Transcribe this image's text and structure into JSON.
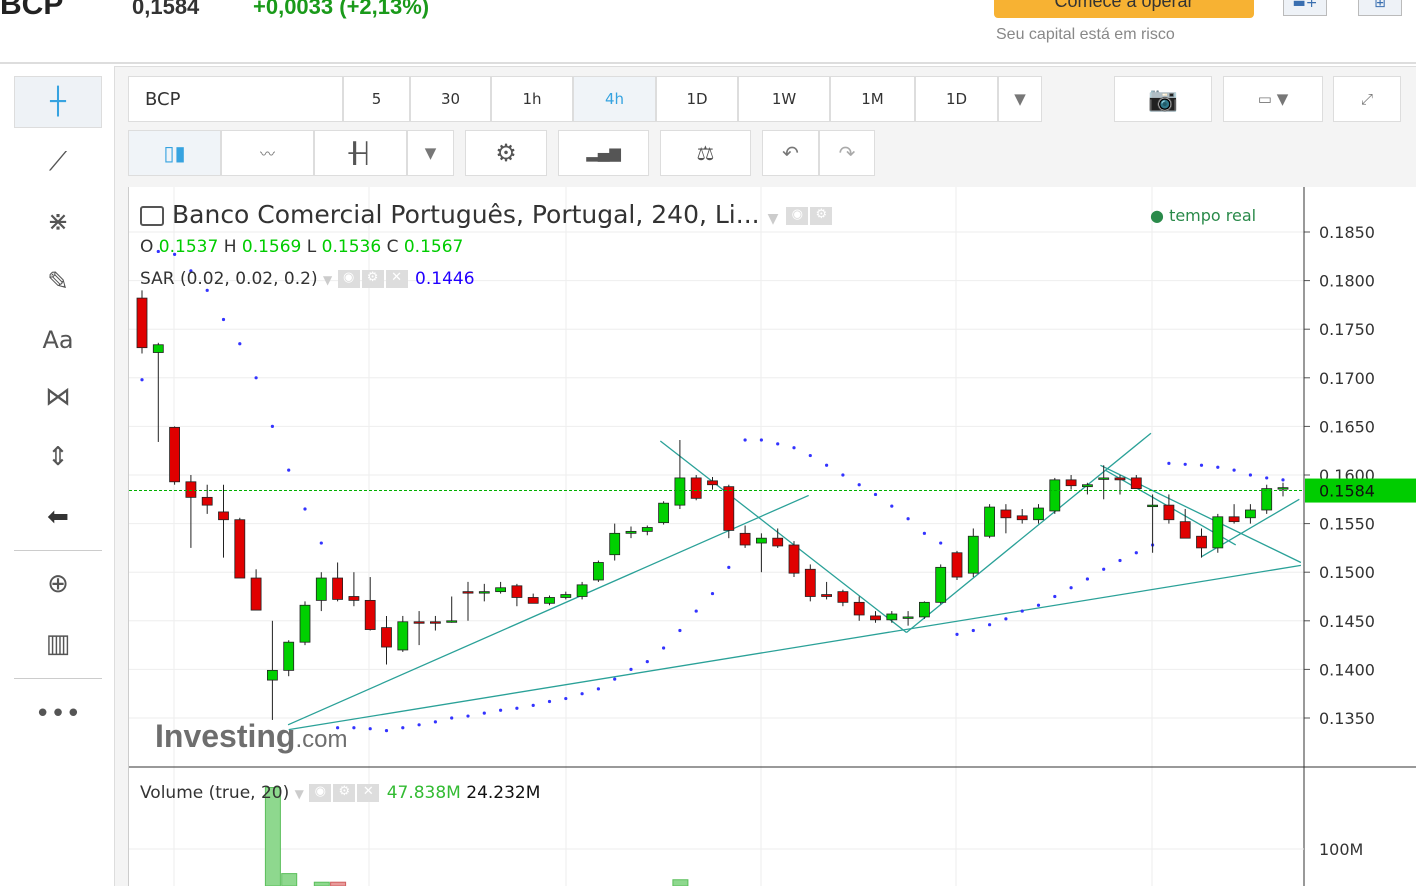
{
  "header": {
    "symbol": "BCP",
    "price": "0,1584",
    "change": "+0,0033 (+2,13%)",
    "cta": "Comece a operar",
    "risk": "Seu capital está em risco"
  },
  "toolbar": {
    "symbol": "BCP",
    "intervals": [
      "5",
      "30",
      "1h",
      "4h",
      "1D",
      "1W",
      "1M",
      "1D"
    ],
    "active_interval": "4h"
  },
  "legend": {
    "title": "Banco Comercial Português, Portugal, 240, Li...",
    "realtime": "tempo real",
    "o_label": "O",
    "o": "0.1537",
    "h_label": "H",
    "h": "0.1569",
    "l_label": "L",
    "l": "0.1536",
    "c_label": "C",
    "c": "0.1567",
    "sar_label": "SAR (0.02, 0.02, 0.2)",
    "sar_value": "0.1446",
    "vol_label": "Volume (true, 20)",
    "vol_value1": "47.838M",
    "vol_value2": "24.232M"
  },
  "logo": "Investing.com",
  "colors": {
    "up": "#00d000",
    "down": "#e00000",
    "sar": "#3333ff",
    "trend": "#2aa198",
    "price_line": "#00b000"
  },
  "chart_data": {
    "type": "candlestick",
    "price_axis": {
      "ticks": [
        "0.1850",
        "0.1800",
        "0.1750",
        "0.1700",
        "0.1650",
        "0.1600",
        "0.1550",
        "0.1500",
        "0.1450",
        "0.1400",
        "0.1350"
      ],
      "ylim": [
        0.1325,
        0.1875
      ]
    },
    "current_price": "0.1584",
    "volume_axis": {
      "ticks": [
        "100M"
      ]
    },
    "ohlc": [
      [
        0.1782,
        0.179,
        0.1725,
        0.1731
      ],
      [
        0.1726,
        0.1736,
        0.1634,
        0.1734
      ],
      [
        0.1649,
        0.165,
        0.159,
        0.1593
      ],
      [
        0.1593,
        0.16,
        0.1525,
        0.1577
      ],
      [
        0.1577,
        0.159,
        0.156,
        0.1569
      ],
      [
        0.1562,
        0.159,
        0.1515,
        0.1554
      ],
      [
        0.1554,
        0.1556,
        0.1494,
        0.1494
      ],
      [
        0.1494,
        0.1503,
        0.1461,
        0.1461
      ],
      [
        0.1389,
        0.145,
        0.1348,
        0.1399
      ],
      [
        0.1399,
        0.143,
        0.1393,
        0.1428
      ],
      [
        0.1428,
        0.147,
        0.1425,
        0.1466
      ],
      [
        0.1471,
        0.15,
        0.146,
        0.1494
      ],
      [
        0.1494,
        0.151,
        0.147,
        0.1472
      ],
      [
        0.1475,
        0.15,
        0.1465,
        0.1471
      ],
      [
        0.1471,
        0.1495,
        0.144,
        0.1441
      ],
      [
        0.1443,
        0.1455,
        0.1405,
        0.1423
      ],
      [
        0.142,
        0.1455,
        0.1418,
        0.1449
      ],
      [
        0.1449,
        0.146,
        0.1425,
        0.1448
      ],
      [
        0.1449,
        0.1455,
        0.144,
        0.1448
      ],
      [
        0.145,
        0.1475,
        0.1448,
        0.145
      ],
      [
        0.148,
        0.149,
        0.145,
        0.1479
      ],
      [
        0.148,
        0.1488,
        0.147,
        0.148
      ],
      [
        0.148,
        0.149,
        0.1478,
        0.1484
      ],
      [
        0.1486,
        0.1488,
        0.1465,
        0.1474
      ],
      [
        0.1474,
        0.1478,
        0.1468,
        0.1468
      ],
      [
        0.1468,
        0.1476,
        0.1466,
        0.1474
      ],
      [
        0.1474,
        0.148,
        0.1472,
        0.1477
      ],
      [
        0.1475,
        0.149,
        0.1472,
        0.1487
      ],
      [
        0.1492,
        0.1512,
        0.149,
        0.151
      ],
      [
        0.1518,
        0.155,
        0.1512,
        0.154
      ],
      [
        0.154,
        0.1547,
        0.1535,
        0.1542
      ],
      [
        0.1542,
        0.1548,
        0.1538,
        0.1546
      ],
      [
        0.1551,
        0.1573,
        0.1549,
        0.1571
      ],
      [
        0.1569,
        0.1636,
        0.1565,
        0.1597
      ],
      [
        0.1597,
        0.16,
        0.1574,
        0.1576
      ],
      [
        0.1594,
        0.1598,
        0.1585,
        0.159
      ],
      [
        0.1588,
        0.159,
        0.1535,
        0.1543
      ],
      [
        0.154,
        0.1548,
        0.1525,
        0.1528
      ],
      [
        0.153,
        0.154,
        0.15,
        0.1535
      ],
      [
        0.1535,
        0.1545,
        0.1525,
        0.1527
      ],
      [
        0.1528,
        0.1532,
        0.1495,
        0.1499
      ],
      [
        0.1503,
        0.1508,
        0.147,
        0.1475
      ],
      [
        0.1477,
        0.149,
        0.1472,
        0.1475
      ],
      [
        0.148,
        0.1482,
        0.1465,
        0.1469
      ],
      [
        0.1469,
        0.1475,
        0.145,
        0.1456
      ],
      [
        0.1455,
        0.146,
        0.1448,
        0.1451
      ],
      [
        0.1451,
        0.146,
        0.1448,
        0.1457
      ],
      [
        0.1454,
        0.146,
        0.1445,
        0.1454
      ],
      [
        0.1454,
        0.147,
        0.1452,
        0.1469
      ],
      [
        0.1469,
        0.1508,
        0.1467,
        0.1505
      ],
      [
        0.152,
        0.1522,
        0.1492,
        0.1495
      ],
      [
        0.1499,
        0.1545,
        0.1495,
        0.1537
      ],
      [
        0.1537,
        0.157,
        0.1535,
        0.1567
      ],
      [
        0.1564,
        0.157,
        0.154,
        0.1556
      ],
      [
        0.1558,
        0.1565,
        0.155,
        0.1554
      ],
      [
        0.1554,
        0.157,
        0.155,
        0.1566
      ],
      [
        0.1563,
        0.1597,
        0.156,
        0.1595
      ],
      [
        0.1595,
        0.16,
        0.1585,
        0.1589
      ],
      [
        0.1588,
        0.1592,
        0.158,
        0.159
      ],
      [
        0.1597,
        0.161,
        0.1575,
        0.1597
      ],
      [
        0.1597,
        0.16,
        0.158,
        0.1595
      ],
      [
        0.1597,
        0.16,
        0.1586,
        0.1586
      ],
      [
        0.1569,
        0.158,
        0.152,
        0.1569
      ],
      [
        0.1569,
        0.158,
        0.155,
        0.1554
      ],
      [
        0.1552,
        0.1565,
        0.1535,
        0.1535
      ],
      [
        0.1537,
        0.1545,
        0.1515,
        0.1525
      ],
      [
        0.1525,
        0.156,
        0.152,
        0.1557
      ],
      [
        0.1557,
        0.157,
        0.155,
        0.1552
      ],
      [
        0.1556,
        0.157,
        0.155,
        0.1564
      ],
      [
        0.1564,
        0.159,
        0.156,
        0.1586
      ],
      [
        0.1586,
        0.1592,
        0.1578,
        0.1587
      ]
    ],
    "sar": [
      0.1698,
      0.183,
      0.1827,
      0.181,
      0.179,
      0.176,
      0.1735,
      0.17,
      0.165,
      0.1605,
      0.1565,
      0.153,
      0.134,
      0.134,
      0.1339,
      0.1337,
      0.134,
      0.1343,
      0.1346,
      0.135,
      0.1352,
      0.1355,
      0.1358,
      0.136,
      0.1363,
      0.1367,
      0.137,
      0.1375,
      0.138,
      0.139,
      0.14,
      0.1408,
      0.1422,
      0.144,
      0.146,
      0.1478,
      0.1505,
      0.1636,
      0.1636,
      0.1632,
      0.1628,
      0.162,
      0.161,
      0.16,
      0.159,
      0.158,
      0.1568,
      0.1555,
      0.154,
      0.153,
      0.1436,
      0.144,
      0.1446,
      0.1452,
      0.146,
      0.1466,
      0.1475,
      0.1484,
      0.1493,
      0.1503,
      0.1512,
      0.152,
      0.1528,
      0.1612,
      0.1611,
      0.161,
      0.1608,
      0.1605,
      0.16,
      0.1597,
      0.1595
    ],
    "trendlines": [
      [
        9.96,
        0.1343,
        41.9,
        0.1579
      ],
      [
        10,
        0.1338,
        72.1,
        0.1507
      ],
      [
        32.8,
        0.1635,
        47.9,
        0.1438
      ],
      [
        47.9,
        0.1438,
        62.9,
        0.1643
      ],
      [
        59.8,
        0.161,
        72.1,
        0.151
      ],
      [
        66,
        0.1516,
        72,
        0.1575
      ],
      [
        60.1,
        0.1605,
        68.1,
        0.1528
      ]
    ],
    "volume": [
      {
        "i": 9,
        "v": 150,
        "up": true
      },
      {
        "i": 10,
        "v": 80,
        "up": true
      },
      {
        "i": 12,
        "v": 73,
        "up": true
      },
      {
        "i": 13,
        "v": 73,
        "up": false
      },
      {
        "i": 34,
        "v": 75,
        "up": true
      }
    ]
  }
}
